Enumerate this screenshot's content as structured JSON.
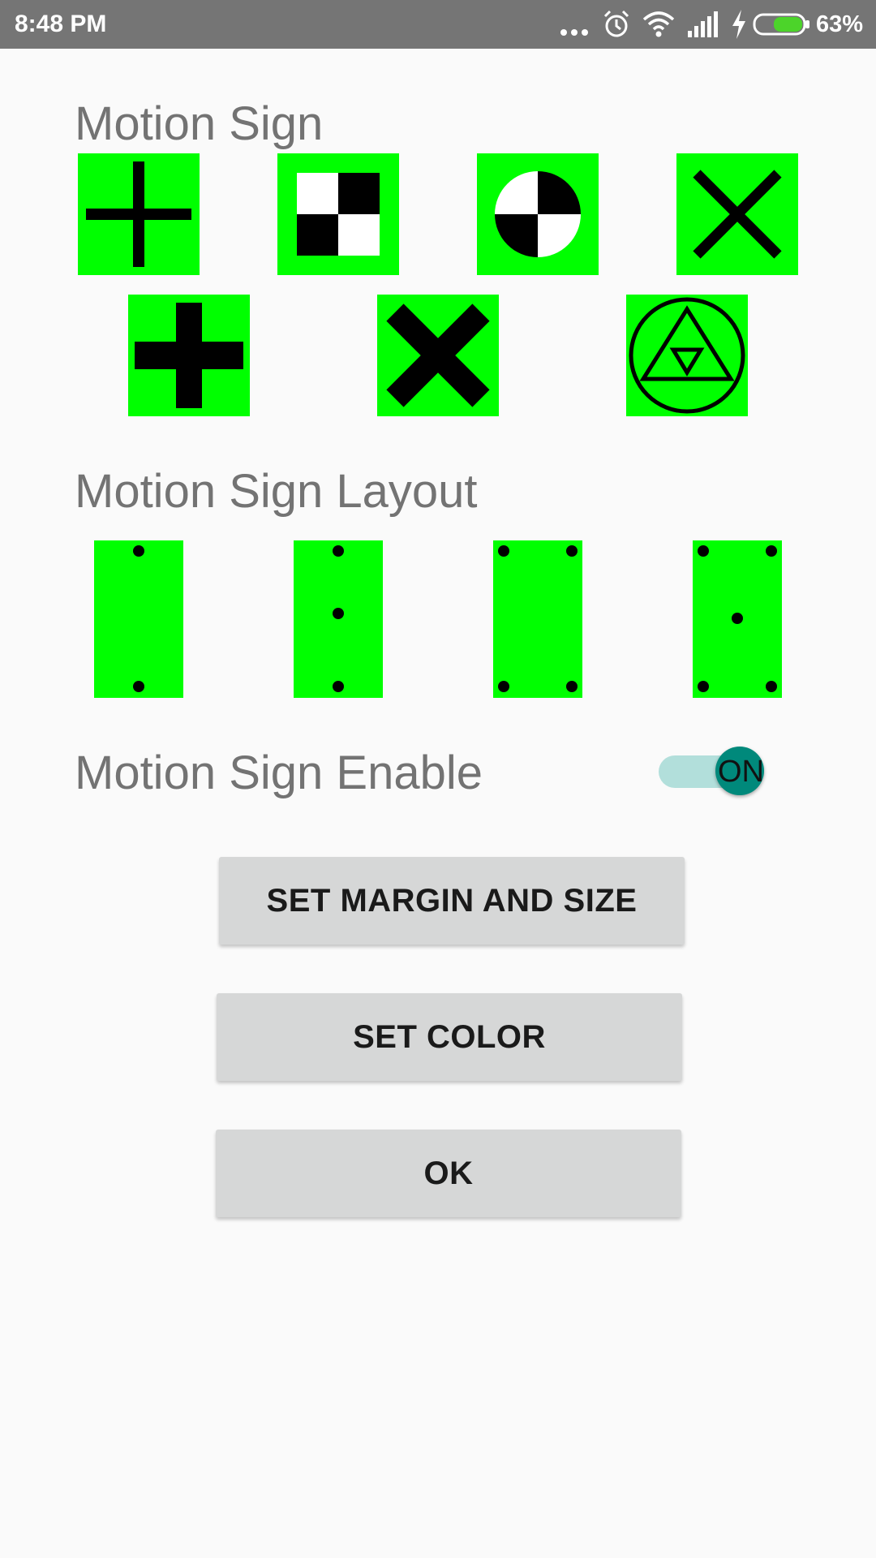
{
  "status_bar": {
    "time": "8:48 PM",
    "battery_percent": "63%",
    "battery_level": 0.63,
    "icons": [
      "more-dots-icon",
      "alarm-icon",
      "wifi-icon",
      "signal-icon",
      "charging-icon",
      "battery-icon"
    ]
  },
  "motion_sign": {
    "title": "Motion Sign",
    "options": [
      "thin-cross-icon",
      "checker-icon",
      "quartered-circle-icon",
      "thin-x-icon",
      "bold-cross-icon",
      "bold-x-icon",
      "triangle-in-circle-icon"
    ]
  },
  "motion_sign_layout": {
    "title": "Motion Sign Layout",
    "options": [
      "layout-top-bottom",
      "layout-top-middle-bottom",
      "layout-four-corners",
      "layout-four-corners-center"
    ]
  },
  "motion_sign_enable": {
    "label": "Motion Sign Enable",
    "state_label": "ON",
    "checked": true
  },
  "buttons": {
    "margin_size": "SET MARGIN AND SIZE",
    "color": "SET COLOR",
    "ok": "OK"
  },
  "colors": {
    "sign_green": "#00ff00",
    "switch_thumb": "#00897b",
    "switch_track": "#b2dfdb",
    "status_bar": "#757575",
    "button_bg": "#d6d7d7",
    "title_text": "#737373"
  }
}
